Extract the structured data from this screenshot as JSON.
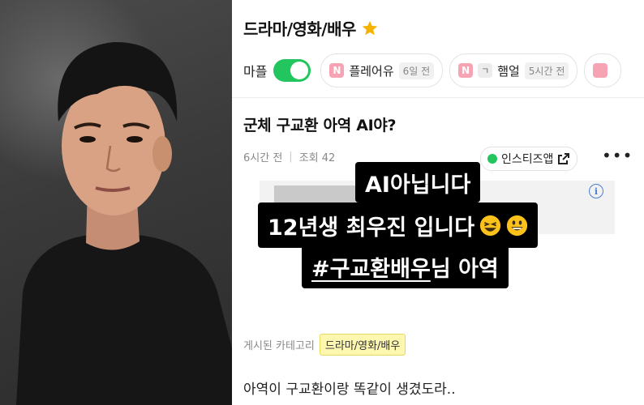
{
  "category": {
    "title": "드라마/영화/배우"
  },
  "filters": {
    "mapul_label": "마플",
    "chips": [
      {
        "badge": "N",
        "name": "플레어유",
        "time": "6일 전"
      },
      {
        "badge": "N",
        "sub_badge": "ㄱ",
        "name": "햄얼",
        "time": "5시간 전"
      }
    ]
  },
  "post": {
    "title": "군체 구교환 아역 AI야?",
    "time": "6시간 전",
    "views": "조회 42",
    "instagram_button": "인스티즈앱",
    "category_label": "게시된 카테고리",
    "category_tag": "드라마/영화/배우",
    "body": "아역이 구교환이랑 똑같이 생겼도라.."
  },
  "overlay": {
    "line1": "AI아닙니다",
    "line2": "12년생 최우진 입니다",
    "line3_tag": "#구교환배우",
    "line3_rest": "님 아역"
  },
  "colors": {
    "toggle_on": "#22c55e",
    "star": "#f5b301",
    "tag_highlight": "#fdf7b0",
    "badge_n": "#f6a3b4"
  }
}
